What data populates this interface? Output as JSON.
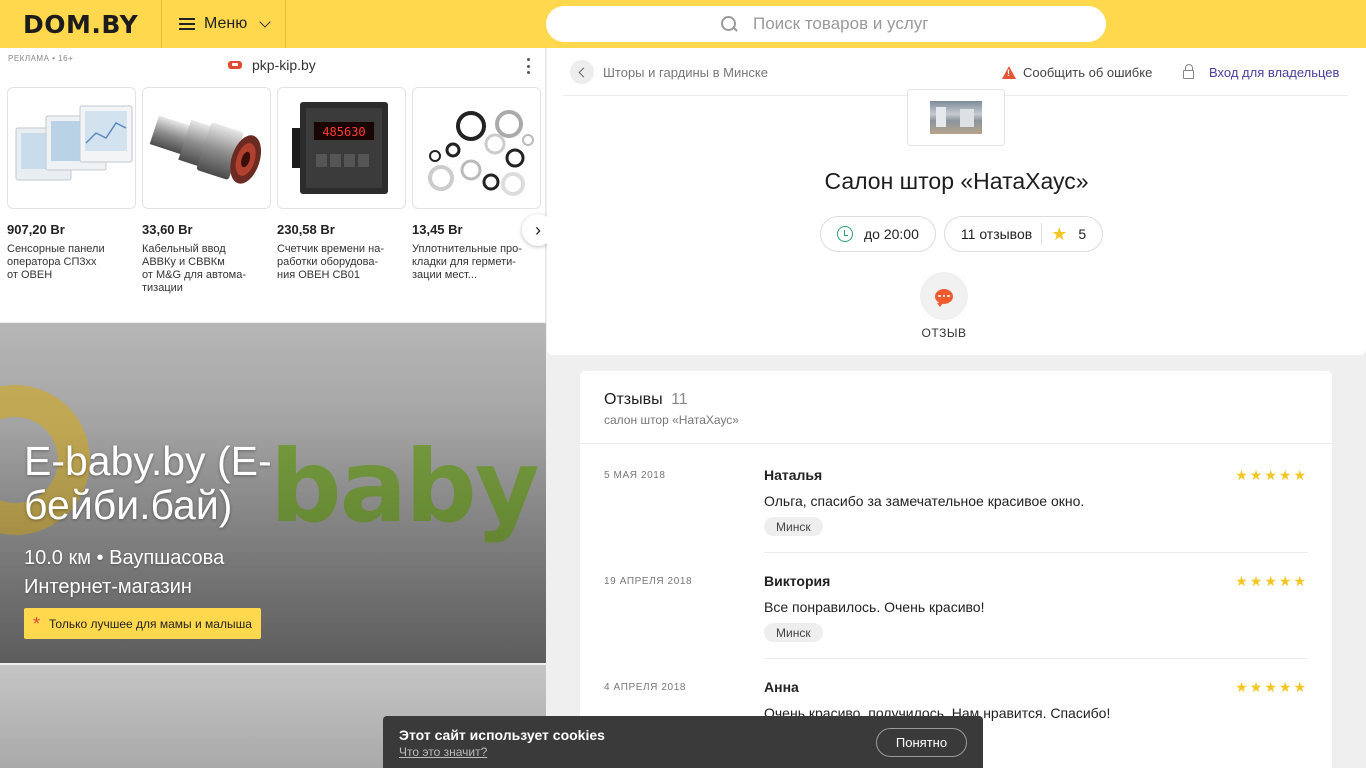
{
  "header": {
    "logo": "DOM.BY",
    "menu_label": "Меню",
    "search_placeholder": "Поиск товаров и услуг"
  },
  "ad": {
    "label": "РЕКЛАМА • 16+",
    "source": "pkp-kip.by",
    "products": [
      {
        "price": "907,20 Br",
        "desc": "Сенсорные панели\nоператора СП3хх\nот ОВЕН"
      },
      {
        "price": "33,60 Br",
        "desc": "Кабельный ввод\nАВВКу и СВВКм\nот M&G для автома-\nтизации"
      },
      {
        "price": "230,58 Br",
        "desc": "Счетчик времени на-\nработки оборудова-\nния ОВЕН СВ01"
      },
      {
        "price": "13,45 Br",
        "desc": "Уплотнительные про-\nкладки для гермети-\nзации мест..."
      }
    ],
    "counter_display": "485630"
  },
  "banner": {
    "bg_text": "baby",
    "title": "E-baby.by (E-бейби.бай)",
    "distance": "10.0 км • Ваупшасова",
    "category": "Интернет-магазин",
    "promo": "Только лучшее для мамы и малыша"
  },
  "company": {
    "breadcrumb": "Шторы и гардины в Минске",
    "report": "Сообщить об ошибке",
    "owner_login": "Вход для владельцев",
    "name": "Салон штор «НатаХаус»",
    "hours": "до 20:00",
    "reviews_count": "11 отзывов",
    "rating": "5",
    "review_action": "ОТЗЫВ"
  },
  "reviews": {
    "title": "Отзывы",
    "count": "11",
    "subtitle": "салон штор «НатаХаус»",
    "items": [
      {
        "date": "5 мая 2018",
        "author": "Наталья",
        "text": "Ольга, спасибо за замечательное красивое окно.",
        "city": "Минск",
        "rating": 5
      },
      {
        "date": "19 апреля 2018",
        "author": "Виктория",
        "text": "Все понравилось. Очень красиво!",
        "city": "Минск",
        "rating": 5
      },
      {
        "date": "4 апреля 2018",
        "author": "Анна",
        "text": "Очень красиво, получилось. Нам нравится. Спасибо!",
        "city": "",
        "rating": 5
      }
    ]
  },
  "cookie": {
    "title": "Этот сайт использует cookies",
    "link": "Что это значит?",
    "accept": "Понятно"
  },
  "colors": {
    "brand_yellow": "#ffd84d",
    "star": "#f3c623",
    "accent_orange": "#ef5a2e",
    "link_purple": "#4a3e9e"
  }
}
